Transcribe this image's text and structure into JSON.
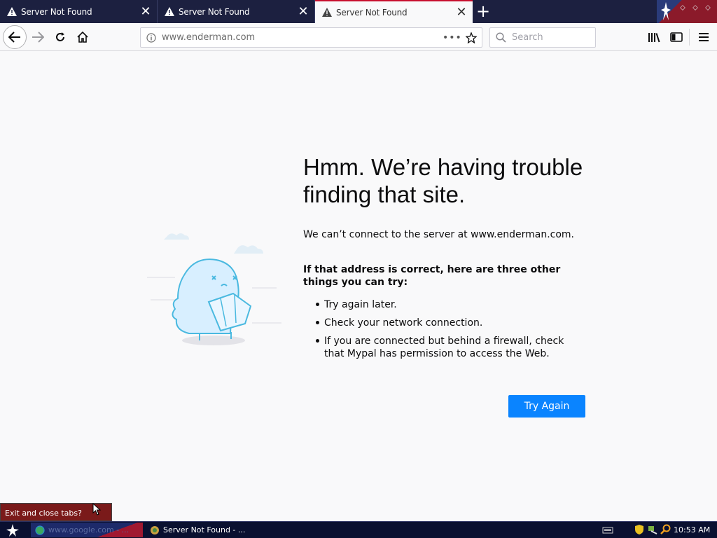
{
  "tabs": [
    {
      "title": "Server Not Found",
      "active": false
    },
    {
      "title": "Server Not Found",
      "active": false
    },
    {
      "title": "Server Not Found",
      "active": true
    }
  ],
  "navbar": {
    "url": "www.enderman.com",
    "url_actions": "•••",
    "search_placeholder": "Search"
  },
  "error": {
    "title": "Hmm. We’re having trouble finding that site.",
    "description": "We can’t connect to the server at www.enderman.com.",
    "tips_heading": "If that address is correct, here are three other things you can try:",
    "tips": [
      "Try again later.",
      "Check your network connection.",
      "If you are connected but behind a firewall, check that Mypal has permission to access the Web."
    ],
    "button_label": "Try Again"
  },
  "tooltip": {
    "text": "Exit and close tabs?"
  },
  "taskbar": {
    "task1_label": "www.google.com - ...",
    "task2_label": "Server Not Found - ...",
    "clock": "10:53 AM"
  },
  "colors": {
    "accent_button": "#0a84ff",
    "tabstrip": "#1c2040",
    "active_tab_line": "#c8102e"
  },
  "icons": [
    "warning-icon",
    "close-icon",
    "plus-icon",
    "back-arrow-icon",
    "forward-arrow-icon",
    "reload-icon",
    "home-icon",
    "info-icon",
    "star-icon",
    "search-icon",
    "library-icon",
    "sidebar-icon",
    "menu-icon",
    "start-star-icon"
  ]
}
